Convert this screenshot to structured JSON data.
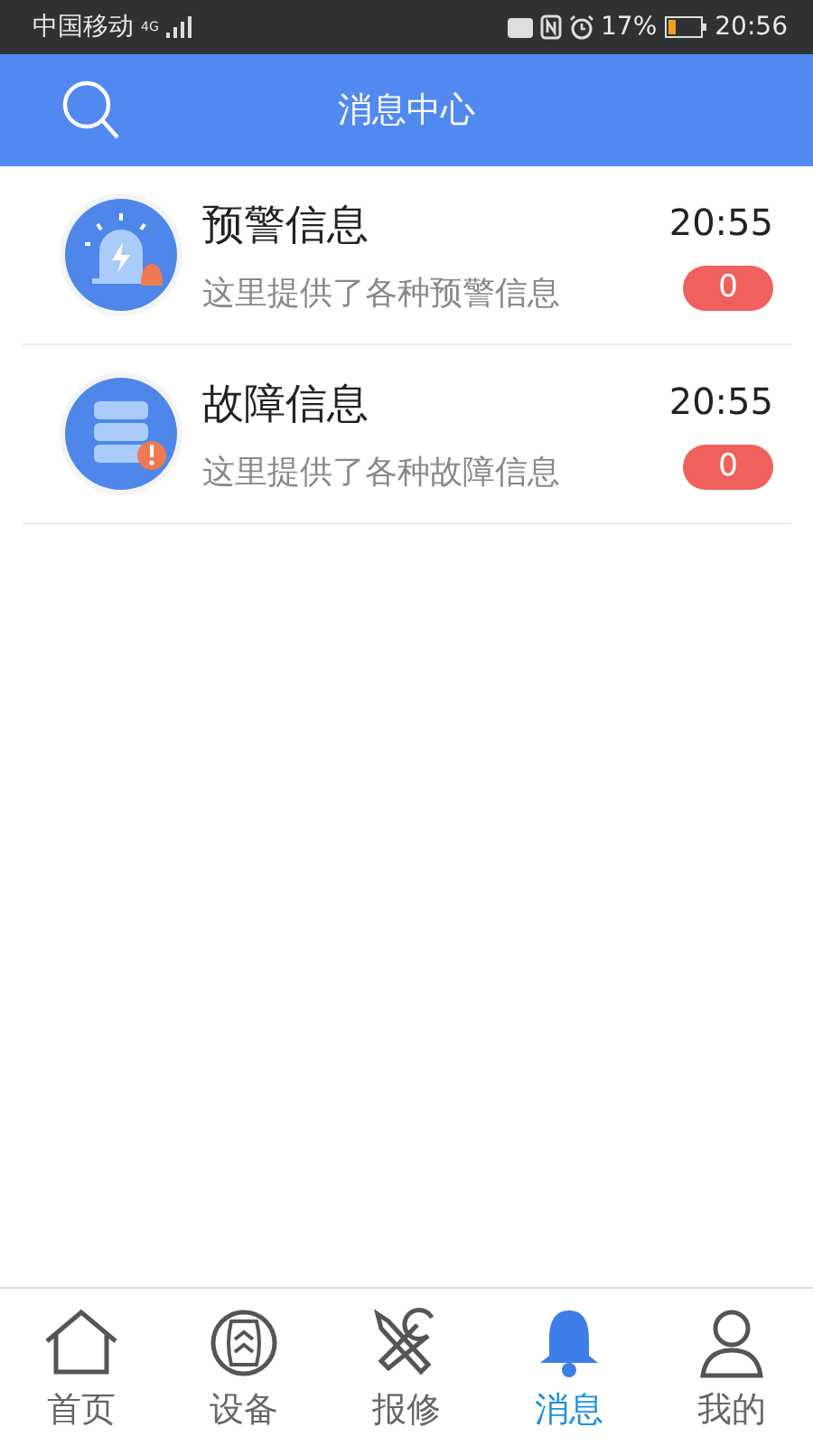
{
  "status_bar": {
    "carrier": "中国移动",
    "network": "4G",
    "battery_percent": "17%",
    "time": "20:56"
  },
  "header": {
    "title": "消息中心"
  },
  "messages": [
    {
      "kind": "warning",
      "title": "预警信息",
      "description": "这里提供了各种预警信息",
      "time": "20:55",
      "count": "0"
    },
    {
      "kind": "fault",
      "title": "故障信息",
      "description": "这里提供了各种故障信息",
      "time": "20:55",
      "count": "0"
    }
  ],
  "tab_bar": [
    {
      "kind": "home",
      "label": "首页",
      "selected": false
    },
    {
      "kind": "device",
      "label": "设备",
      "selected": false
    },
    {
      "kind": "repair",
      "label": "报修",
      "selected": false
    },
    {
      "kind": "message",
      "label": "消息",
      "selected": true
    },
    {
      "kind": "profile",
      "label": "我的",
      "selected": false
    }
  ]
}
